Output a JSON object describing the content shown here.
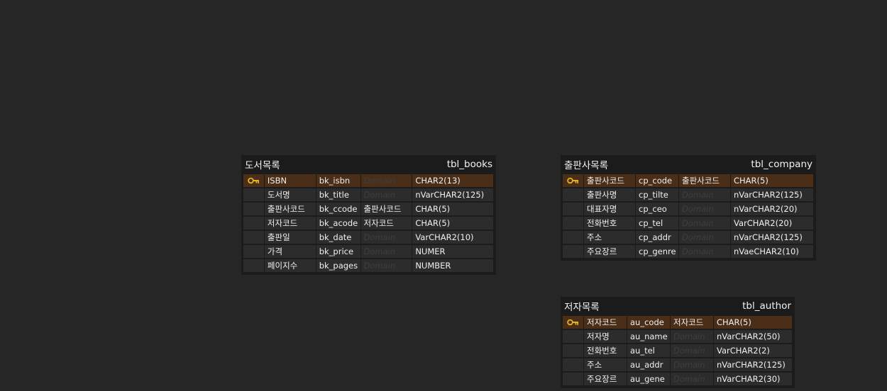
{
  "colors": {
    "background": "#262626",
    "table_bg": "#1b1b1b",
    "cell_bg": "#2c2c2c",
    "pk_row_bg": "#4a2e18",
    "key_icon": "#e6b325",
    "text": "#f0f0f0",
    "placeholder": "#3e3e3e"
  },
  "tables": [
    {
      "id": "tbl_books",
      "logical_name": "도서목록",
      "physical_name": "tbl_books",
      "columns": [
        {
          "pk": true,
          "logical": "ISBN",
          "physical": "bk_isbn",
          "domain": "Domain",
          "domain_empty": true,
          "type": "CHAR2(13)"
        },
        {
          "pk": false,
          "logical": "도서명",
          "physical": "bk_title",
          "domain": "Domain",
          "domain_empty": true,
          "type": "nVarCHAR2(125)"
        },
        {
          "pk": false,
          "logical": "출판사코드",
          "physical": "bk_ccode",
          "domain": "출판사코드",
          "domain_empty": false,
          "type": "CHAR(5)"
        },
        {
          "pk": false,
          "logical": "저자코드",
          "physical": "bk_acode",
          "domain": "저자코드",
          "domain_empty": false,
          "type": "CHAR(5)"
        },
        {
          "pk": false,
          "logical": "출판일",
          "physical": "bk_date",
          "domain": "Domain",
          "domain_empty": true,
          "type": "VarCHAR2(10)"
        },
        {
          "pk": false,
          "logical": "가격",
          "physical": "bk_price",
          "domain": "Domain",
          "domain_empty": true,
          "type": "NUMER"
        },
        {
          "pk": false,
          "logical": "페이지수",
          "physical": "bk_pages",
          "domain": "Domain",
          "domain_empty": true,
          "type": "NUMBER"
        }
      ]
    },
    {
      "id": "tbl_company",
      "logical_name": "출판사목록",
      "physical_name": "tbl_company",
      "columns": [
        {
          "pk": true,
          "logical": "출판사코드",
          "physical": "cp_code",
          "domain": "출판사코드",
          "domain_empty": false,
          "type": "CHAR(5)"
        },
        {
          "pk": false,
          "logical": "출판사명",
          "physical": "cp_tilte",
          "domain": "Domain",
          "domain_empty": true,
          "type": "nVarCHAR2(125)"
        },
        {
          "pk": false,
          "logical": "대표자명",
          "physical": "cp_ceo",
          "domain": "Domain",
          "domain_empty": true,
          "type": "nVarCHAR2(20)"
        },
        {
          "pk": false,
          "logical": "전화번호",
          "physical": "cp_tel",
          "domain": "Domain",
          "domain_empty": true,
          "type": "VarCHAR2(20)"
        },
        {
          "pk": false,
          "logical": "주소",
          "physical": "cp_addr",
          "domain": "Domain",
          "domain_empty": true,
          "type": "nVarCHAR2(125)"
        },
        {
          "pk": false,
          "logical": "주요장르",
          "physical": "cp_genre",
          "domain": "Domain",
          "domain_empty": true,
          "type": "nVaeCHAR2(10)"
        }
      ]
    },
    {
      "id": "tbl_author",
      "logical_name": "저자목록",
      "physical_name": "tbl_author",
      "columns": [
        {
          "pk": true,
          "logical": "저자코드",
          "physical": "au_code",
          "domain": "저자코드",
          "domain_empty": false,
          "type": "CHAR(5)"
        },
        {
          "pk": false,
          "logical": "저자명",
          "physical": "au_name",
          "domain": "Domain",
          "domain_empty": true,
          "type": "nVarCHAR2(50)"
        },
        {
          "pk": false,
          "logical": "전화번호",
          "physical": "au_tel",
          "domain": "Domain",
          "domain_empty": true,
          "type": "VarCHAR2(2)"
        },
        {
          "pk": false,
          "logical": "주소",
          "physical": "au_addr",
          "domain": "Domain",
          "domain_empty": true,
          "type": "nVarCHAR2(125)"
        },
        {
          "pk": false,
          "logical": "주요장르",
          "physical": "au_gene",
          "domain": "Domain",
          "domain_empty": true,
          "type": "nVarCHAR2(30)"
        }
      ]
    }
  ]
}
